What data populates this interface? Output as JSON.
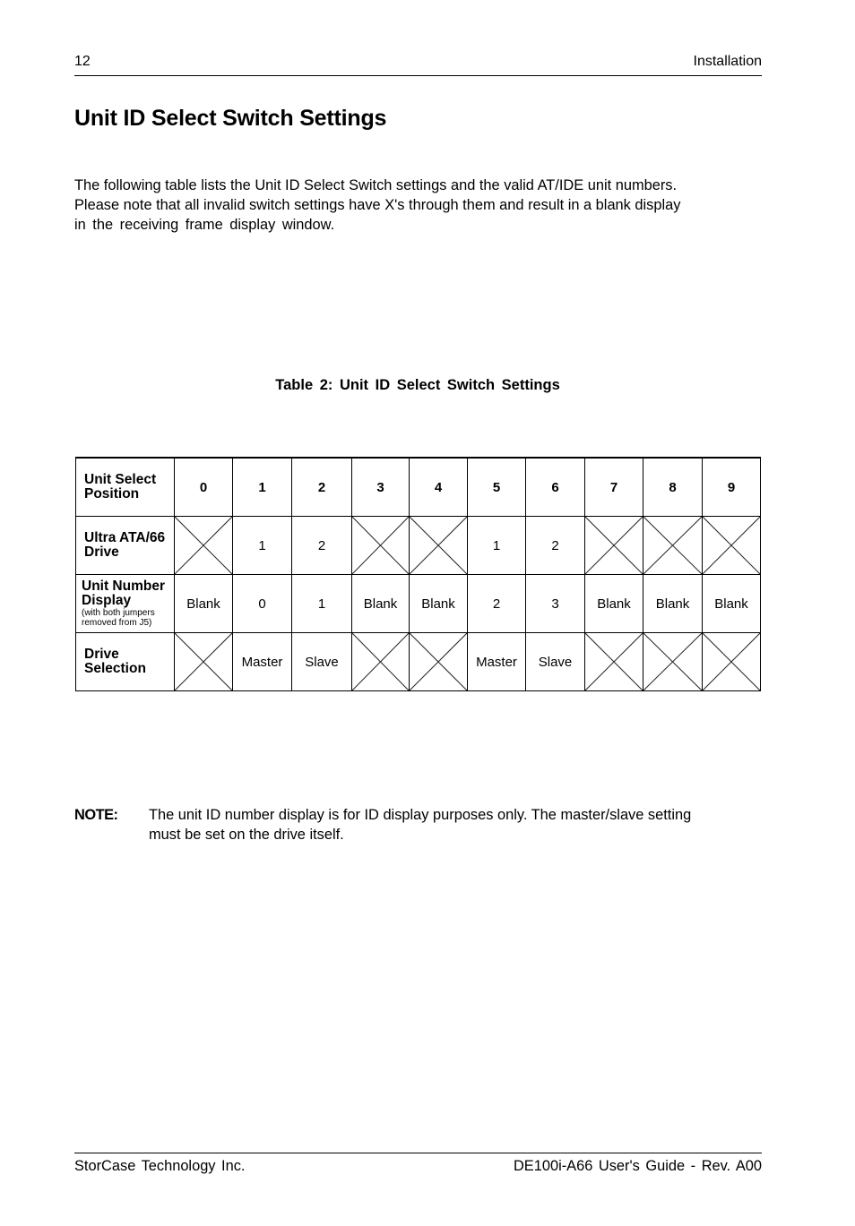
{
  "header": {
    "page_number": "12",
    "section": "Installation"
  },
  "title": "Unit ID Select Switch Settings",
  "intro": {
    "line1": "The following table lists the Unit ID Select Switch settings and the valid AT/IDE unit numbers.",
    "line2": "Please note that all invalid switch settings have X's through them and result in a blank display",
    "line3": "in the receiving frame display window."
  },
  "table": {
    "caption": "Table 2:  Unit ID Select Switch Settings",
    "rows": [
      {
        "header": "Unit Select Position",
        "header_sub": "",
        "bold": true,
        "cells": [
          "0",
          "1",
          "2",
          "3",
          "4",
          "5",
          "6",
          "7",
          "8",
          "9"
        ]
      },
      {
        "header": "Ultra ATA/66 Drive",
        "header_sub": "",
        "bold": false,
        "cells": [
          "X",
          "1",
          "2",
          "X",
          "X",
          "1",
          "2",
          "X",
          "X",
          "X"
        ]
      },
      {
        "header": "Unit Number Display",
        "header_sub": "(with both jumpers removed from J5)",
        "bold": false,
        "cells": [
          "Blank",
          "0",
          "1",
          "Blank",
          "Blank",
          "2",
          "3",
          "Blank",
          "Blank",
          "Blank"
        ]
      },
      {
        "header": "Drive Selection",
        "header_sub": "",
        "bold": false,
        "cells": [
          "X",
          "Master",
          "Slave",
          "X",
          "X",
          "Master",
          "Slave",
          "X",
          "X",
          "X"
        ]
      }
    ]
  },
  "note": {
    "label": "NOTE:",
    "line1": "The unit ID number display is for ID display purposes only.  The master/slave setting",
    "line2": "must be set on the drive itself."
  },
  "footer": {
    "company": "StorCase Technology Inc.",
    "document": "DE100i-A66 User's Guide - Rev. A00"
  }
}
